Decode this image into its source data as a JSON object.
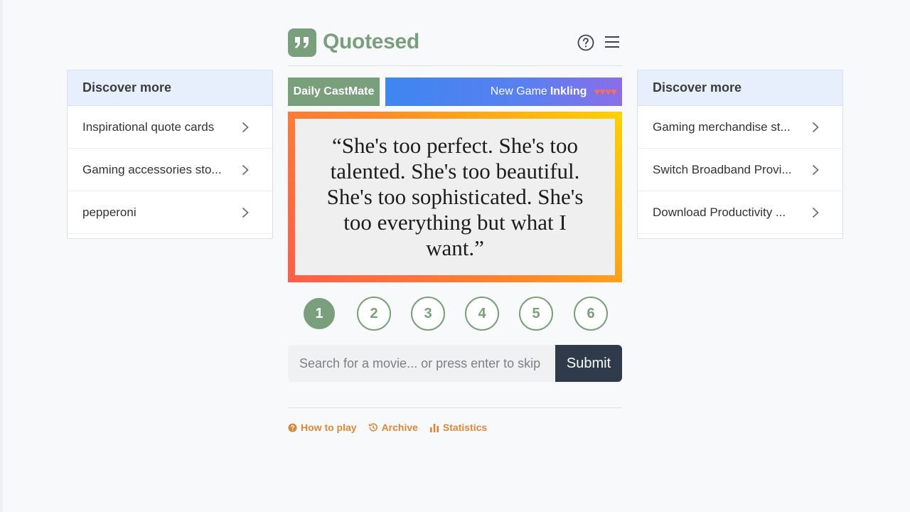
{
  "app": {
    "title": "Quotesed"
  },
  "left_panel": {
    "heading": "Discover more",
    "items": [
      {
        "label": "Inspirational quote cards"
      },
      {
        "label": "Gaming accessories sto..."
      },
      {
        "label": "pepperoni"
      }
    ]
  },
  "right_panel": {
    "heading": "Discover more",
    "items": [
      {
        "label": "Gaming merchandise st..."
      },
      {
        "label": "Switch Broadband Provi..."
      },
      {
        "label": "Download Productivity ..."
      }
    ]
  },
  "banner": {
    "daily_label": "Daily CastMate",
    "new_game_prefix": "New Game",
    "new_game_name": "Inkling",
    "hearts": "♥♥♥♥"
  },
  "quote": {
    "text": "“She's too perfect. She's too talented. She's too beautiful. She's too sophisticated. She's too everything but what I want.”"
  },
  "steps": {
    "active": 1,
    "items": [
      "1",
      "2",
      "3",
      "4",
      "5",
      "6"
    ]
  },
  "search": {
    "placeholder": "Search for a movie... or press enter to skip",
    "value": "",
    "submit_label": "Submit"
  },
  "footer": {
    "links": [
      {
        "label": "How to play",
        "icon": "help-circle-icon"
      },
      {
        "label": "Archive",
        "icon": "history-icon"
      },
      {
        "label": "Statistics",
        "icon": "bar-chart-icon"
      }
    ]
  },
  "colors": {
    "brand_green": "#7a9f7c",
    "footer_orange": "#d9873f",
    "submit_dark": "#2f3a4b",
    "panel_header": "#e8effc"
  }
}
